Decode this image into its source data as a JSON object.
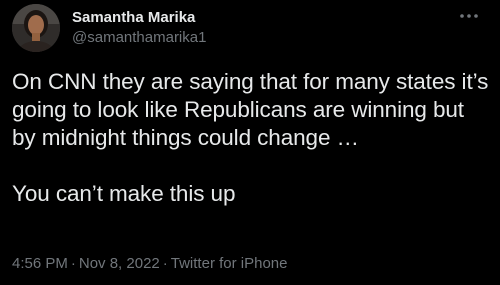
{
  "author": {
    "name": "Samantha Marika",
    "handle": "@samanthamarika1"
  },
  "tweet": {
    "text": "On CNN they are saying that for many states it’s going to look like Republicans are winning but by midnight things could change …\n\nYou can’t make this up"
  },
  "meta": {
    "time": "4:56 PM",
    "separator": "·",
    "date": "Nov 8, 2022",
    "source": "Twitter for iPhone"
  },
  "icons": {
    "more": "more-icon",
    "avatar": "avatar-photo"
  },
  "colors": {
    "background": "#000000",
    "text_primary": "#e7e9ea",
    "text_secondary": "#71767b"
  }
}
